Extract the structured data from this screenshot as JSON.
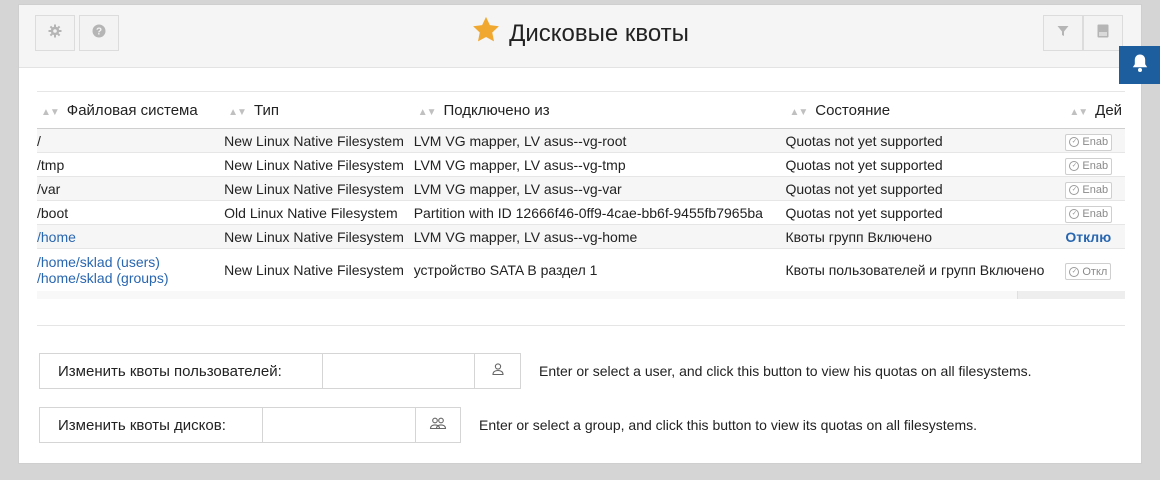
{
  "header": {
    "title": "Дисковые квоты",
    "star_color": "#f0a830"
  },
  "table": {
    "columns": [
      "Файловая система",
      "Тип",
      "Подключено из",
      "Состояние",
      "Дей"
    ],
    "rows": [
      {
        "fs": "/",
        "type": "New Linux Native Filesystem",
        "from": "LVM VG mapper, LV asus--vg-root",
        "state": "Quotas not yet supported",
        "action": "Enab"
      },
      {
        "fs": "/tmp",
        "type": "New Linux Native Filesystem",
        "from": "LVM VG mapper, LV asus--vg-tmp",
        "state": "Quotas not yet supported",
        "action": "Enab"
      },
      {
        "fs": "/var",
        "type": "New Linux Native Filesystem",
        "from": "LVM VG mapper, LV asus--vg-var",
        "state": "Quotas not yet supported",
        "action": "Enab"
      },
      {
        "fs": "/boot",
        "type": "Old Linux Native Filesystem",
        "from": "Partition with ID 12666f46-0ff9-4cae-bb6f-9455fb7965ba",
        "state": "Quotas not yet supported",
        "action": "Enab"
      },
      {
        "fs": "/home",
        "type": "New Linux Native Filesystem",
        "from": "LVM VG mapper, LV asus--vg-home",
        "state": "Квоты групп Включено",
        "action": "Отклю"
      },
      {
        "fs_users": "/home/sklad (users)",
        "fs_groups": "/home/sklad (groups)",
        "type": "New Linux Native Filesystem",
        "from": "устройство SATA B раздел 1",
        "state": "Квоты пользователей и групп Включено",
        "action": "Откл"
      }
    ]
  },
  "user_quota": {
    "label": "Изменить квоты пользователей:",
    "value": "",
    "help": "Enter or select a user, and click this button to view his quotas on all filesystems."
  },
  "group_quota": {
    "label": "Изменить квоты дисков:",
    "value": "",
    "help": "Enter or select a group, and click this button to view its quotas on all filesystems."
  }
}
